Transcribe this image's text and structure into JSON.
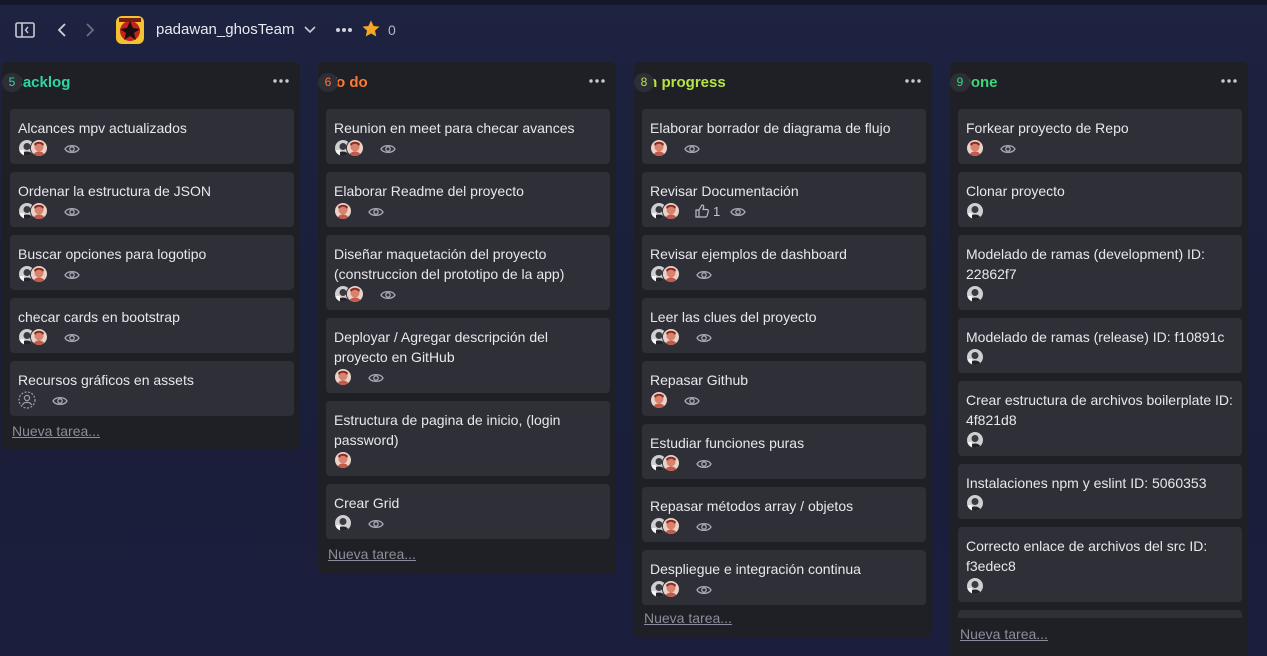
{
  "header": {
    "team_name": "padawan_ghosTeam",
    "star_count": "0"
  },
  "columns": [
    {
      "title": "Backlog",
      "count": "5",
      "color": "#2fd6a4",
      "new_task": "Nueva tarea...",
      "cards": [
        {
          "title": "Alcances mpv actualizados",
          "avatars": [
            "grey",
            "orange"
          ]
        },
        {
          "title": "Ordenar la estructura de JSON",
          "avatars": [
            "grey",
            "orange"
          ]
        },
        {
          "title": "Buscar opciones para logotipo",
          "avatars": [
            "grey",
            "orange"
          ]
        },
        {
          "title": "checar cards en bootstrap",
          "avatars": [
            "grey",
            "orange"
          ]
        },
        {
          "title": "Recursos gráficos en assets",
          "avatars": [
            "none"
          ]
        }
      ]
    },
    {
      "title": "To do",
      "count": "6",
      "color": "#ff7a2f",
      "new_task": "Nueva tarea...",
      "cards": [
        {
          "title": "Reunion en meet para checar avances",
          "avatars": [
            "grey",
            "orange"
          ]
        },
        {
          "title": "Elaborar Readme del proyecto",
          "avatars": [
            "orange"
          ]
        },
        {
          "title": "Diseñar maquetación del proyecto (construccion del prototipo de la app)",
          "avatars": [
            "grey",
            "orange"
          ]
        },
        {
          "title": "Deployar / Agregar descripción del proyecto en GitHub",
          "avatars": [
            "orange"
          ]
        },
        {
          "title": "Estructura de pagina de inicio, (login password)",
          "avatars": [
            "orange"
          ],
          "noeye": true
        },
        {
          "title": "Crear Grid",
          "avatars": [
            "grey"
          ]
        }
      ]
    },
    {
      "title": "In progress",
      "count": "8",
      "color": "#b6e34a",
      "new_task": "Nueva tarea...",
      "cards": [
        {
          "title": "Elaborar borrador de diagrama de flujo",
          "avatars": [
            "orange"
          ]
        },
        {
          "title": "Revisar Documentación",
          "avatars": [
            "grey",
            "orange"
          ],
          "likes": "1"
        },
        {
          "title": "Revisar ejemplos de dashboard",
          "avatars": [
            "grey",
            "orange"
          ]
        },
        {
          "title": "Leer las clues del proyecto",
          "avatars": [
            "grey",
            "orange"
          ]
        },
        {
          "title": "Repasar Github",
          "avatars": [
            "orange"
          ]
        },
        {
          "title": "Estudiar funciones puras",
          "avatars": [
            "grey",
            "orange"
          ]
        },
        {
          "title": "Repasar métodos array / objetos",
          "avatars": [
            "grey",
            "orange"
          ]
        },
        {
          "title": "Despliegue e integración continua",
          "avatars": [
            "grey",
            "orange"
          ]
        }
      ]
    },
    {
      "title": "Done",
      "count": "9",
      "color": "#3ed57a",
      "new_task": "Nueva tarea...",
      "cards": [
        {
          "title": "Forkear proyecto de Repo",
          "avatars": [
            "orange"
          ]
        },
        {
          "title": "Clonar proyecto",
          "avatars": [
            "grey"
          ],
          "noeye": true
        },
        {
          "title": "Modelado de ramas (development) ID: 22862f7",
          "avatars": [
            "grey"
          ],
          "noeye": true
        },
        {
          "title": "Modelado de ramas (release) ID: f10891c",
          "avatars": [
            "grey"
          ],
          "noeye": true
        },
        {
          "title": "Crear estructura de archivos boilerplate ID: 4f821d8",
          "avatars": [
            "grey"
          ],
          "noeye": true
        },
        {
          "title": "Instalaciones npm y eslint ID: 5060353",
          "avatars": [
            "grey"
          ],
          "noeye": true
        },
        {
          "title": "Correcto enlace de archivos del src ID: f3edec8",
          "avatars": [
            "grey"
          ],
          "noeye": true
        }
      ]
    }
  ]
}
